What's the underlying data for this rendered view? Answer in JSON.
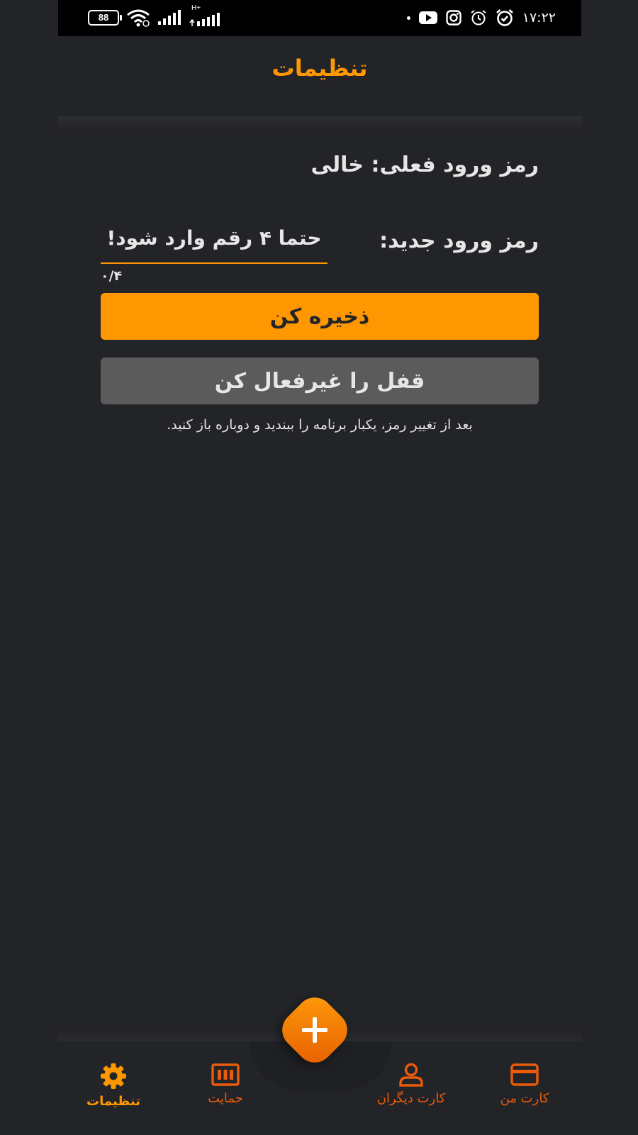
{
  "status_bar": {
    "time": "۱۷:۲۲",
    "battery": "88",
    "network": "H+"
  },
  "header": {
    "title": "تنظیمات"
  },
  "settings": {
    "current_password": "رمز ورود فعلی: خالی",
    "new_password_label": "رمز ورود جدید:",
    "new_password_placeholder": "حتما ۴ رقم وارد شود!",
    "new_password_value": "",
    "counter": "۰/۴",
    "save_button": "ذخیره کن",
    "disable_lock_button": "قفل را غیرفعال کن",
    "note": "بعد از تغییر رمز، یکبار برنامه را ببندید و دوباره باز کنید."
  },
  "bottom_nav": {
    "items": [
      {
        "label": "کارت من",
        "icon": "credit-card-icon"
      },
      {
        "label": "کارت دیگران",
        "icon": "person-icon"
      },
      {
        "label": "حمایت",
        "icon": "cash-icon"
      },
      {
        "label": "تنظیمات",
        "icon": "gear-icon",
        "active": true
      }
    ],
    "fab_icon": "plus-icon"
  },
  "colors": {
    "accent": "#ff9800",
    "nav_inactive": "#ea5b0c",
    "background": "#232427",
    "disabled_button": "#5b5b5b"
  }
}
